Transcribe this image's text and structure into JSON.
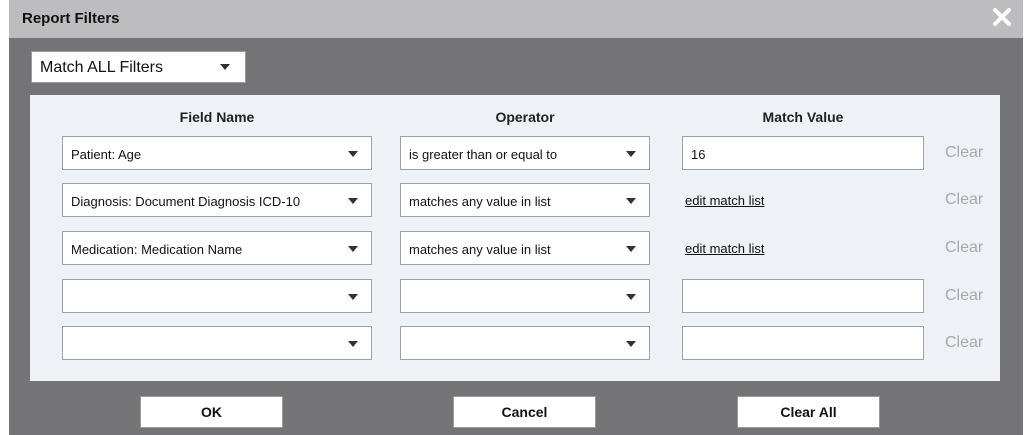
{
  "dialog": {
    "title": "Report Filters",
    "match_mode": "Match ALL Filters"
  },
  "columns": {
    "field_name": "Field Name",
    "operator": "Operator",
    "match_value": "Match Value"
  },
  "rows": [
    {
      "field": "Patient: Age",
      "operator": "is greater than or equal to",
      "value": "16",
      "clear": "Clear"
    },
    {
      "field": "Diagnosis: Document Diagnosis ICD-10",
      "operator": "matches any value in list",
      "link": "edit match list",
      "clear": "Clear"
    },
    {
      "field": "Medication: Medication Name",
      "operator": "matches any value in list",
      "link": "edit match list",
      "clear": "Clear"
    },
    {
      "field": "",
      "operator": "",
      "value": "",
      "clear": "Clear"
    },
    {
      "field": "",
      "operator": "",
      "value": "",
      "clear": "Clear"
    }
  ],
  "buttons": {
    "ok": "OK",
    "cancel": "Cancel",
    "clear_all": "Clear All"
  }
}
